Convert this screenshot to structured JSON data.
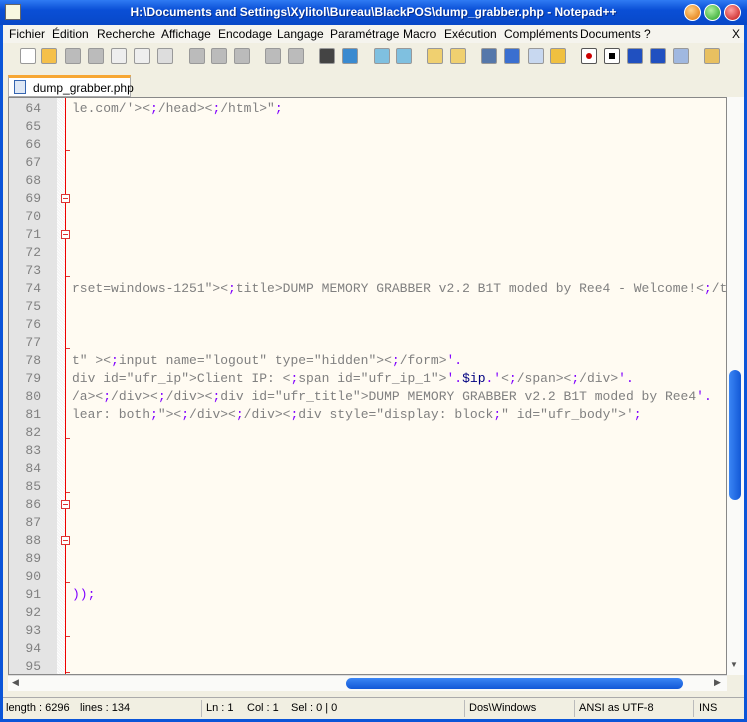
{
  "window": {
    "title": "H:\\Documents and Settings\\Xylitol\\Bureau\\BlackPOS\\dump_grabber.php - Notepad++"
  },
  "menu": [
    "Fichier",
    "Édition",
    "Recherche",
    "Affichage",
    "Encodage",
    "Langage",
    "Paramétrage",
    "Macro",
    "Exécution",
    "Compléments",
    "Documents",
    "?"
  ],
  "menu_close": "X",
  "toolbar_icons": [
    "new-file-icon",
    "open-file-icon",
    "save-icon",
    "save-all-icon",
    "close-icon",
    "close-all-icon",
    "print-icon",
    "cut-icon",
    "copy-icon",
    "paste-icon",
    "undo-icon",
    "redo-icon",
    "find-icon",
    "replace-icon",
    "zoom-in-icon",
    "zoom-out-icon",
    "sync-vertical-icon",
    "sync-horizontal-icon",
    "word-wrap-icon",
    "show-all-chars-icon",
    "indent-guide-icon",
    "user-language-icon",
    "record-macro-icon",
    "stop-macro-icon",
    "play-macro-icon",
    "run-macro-multiple-icon",
    "save-macro-icon",
    "launch-browser-icon"
  ],
  "tab": {
    "label": "dump_grabber.php"
  },
  "editor": {
    "lines": [
      {
        "n": "64",
        "text": "le.com/'></head></html>\";"
      },
      {
        "n": "65",
        "text": ""
      },
      {
        "n": "66",
        "text": ""
      },
      {
        "n": "67",
        "text": ""
      },
      {
        "n": "68",
        "text": ""
      },
      {
        "n": "69",
        "text": ""
      },
      {
        "n": "70",
        "text": ""
      },
      {
        "n": "71",
        "text": ""
      },
      {
        "n": "72",
        "text": ""
      },
      {
        "n": "73",
        "text": ""
      },
      {
        "n": "74",
        "text": "rset=windows-1251\"><title>DUMP MEMORY GRABBER v2.2 B1T moded by Ree4 - Welcome!</t"
      },
      {
        "n": "75",
        "text": ""
      },
      {
        "n": "76",
        "text": ""
      },
      {
        "n": "77",
        "text": ""
      },
      {
        "n": "78",
        "text": "t\" ><input name=\"logout\" type=\"hidden\"></form>'."
      },
      {
        "n": "79",
        "text": "div id=\"ufr_ip\">Client IP: <span id=\"ufr_ip_1\">'.$ip.'</span></div>'."
      },
      {
        "n": "80",
        "text": "/a></div></div><div id=\"ufr_title\">DUMP MEMORY GRABBER v2.2 B1T moded by Ree4'."
      },
      {
        "n": "81",
        "text": "lear: both;\"></div></div><div style=\"display: block;\" id=\"ufr_body\">';"
      },
      {
        "n": "82",
        "text": ""
      },
      {
        "n": "83",
        "text": ""
      },
      {
        "n": "84",
        "text": ""
      },
      {
        "n": "85",
        "text": ""
      },
      {
        "n": "86",
        "text": ""
      },
      {
        "n": "87",
        "text": ""
      },
      {
        "n": "88",
        "text": ""
      },
      {
        "n": "89",
        "text": ""
      },
      {
        "n": "90",
        "text": ""
      },
      {
        "n": "91",
        "text": "));"
      },
      {
        "n": "92",
        "text": ""
      },
      {
        "n": "93",
        "text": ""
      },
      {
        "n": "94",
        "text": ""
      },
      {
        "n": "95",
        "text": ""
      }
    ],
    "fold_boxes": [
      "69",
      "71",
      "86",
      "88"
    ],
    "fold_ticks": [
      "66",
      "73",
      "77",
      "82",
      "85",
      "90",
      "93",
      "95"
    ]
  },
  "status": {
    "length": "length : 6296",
    "lines": "lines : 134",
    "ln": "Ln : 1",
    "col": "Col : 1",
    "sel": "Sel : 0 | 0",
    "eol": "Dos\\Windows",
    "encoding": "ANSI as UTF-8",
    "mode": "INS"
  }
}
